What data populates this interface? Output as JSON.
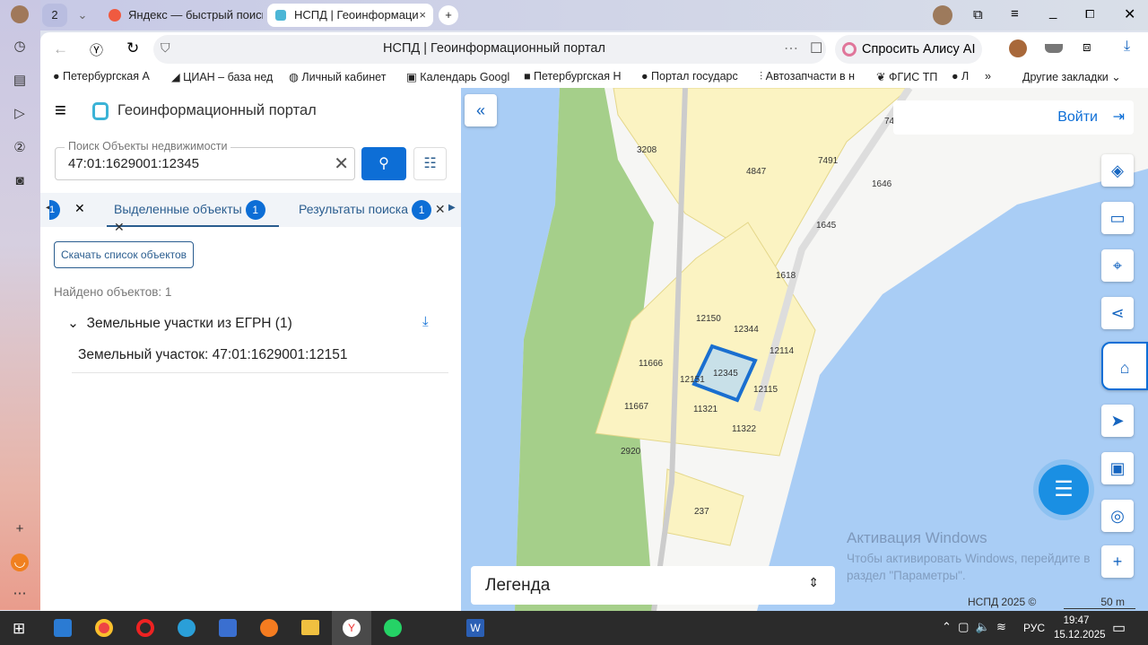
{
  "browser": {
    "tab_count": "2",
    "tabs": [
      {
        "label": "Яндекс — быстрый поиск"
      },
      {
        "label": "НСПД | Геоинформаци"
      }
    ],
    "address_title": "НСПД | Геоинформационный портал",
    "alice_label": "Спросить Алису AI",
    "bookmarks": [
      "Петербургская А",
      "ЦИАН – база нед",
      "Личный кабинет",
      "Календарь Googl",
      "Петербургская Н",
      "Портал государс",
      "Автозапчасти в н",
      "ФГИС ТП",
      "Л"
    ],
    "other_bookmarks": "Другие закладки"
  },
  "portal": {
    "title": "Геоинформационный портал",
    "search": {
      "label": "Поиск Объекты недвижимости",
      "value": "47:01:1629001:12345"
    },
    "tabs": [
      {
        "label": "",
        "count": "1"
      },
      {
        "label": "Выделенные объекты",
        "count": "1"
      },
      {
        "label": "Результаты поиска",
        "count": "1"
      }
    ],
    "download_button": "Скачать список объектов",
    "found": "Найдено объектов: 1",
    "group": "Земельные участки из ЕГРН (1)",
    "item": "Земельный участок: 47:01:1629001:12151"
  },
  "map": {
    "login": "Войти",
    "legend": "Легенда",
    "copyright": "НСПД 2025 ©",
    "scale": "50 m",
    "parcels": [
      "3208",
      "4847",
      "7491",
      "1646",
      "1645",
      "1618",
      "12150",
      "12344",
      "12114",
      "11666",
      "12345",
      "12151",
      "12115",
      "11667",
      "11321",
      "11322",
      "2920",
      "237",
      "74"
    ],
    "watermark_title": "Активация Windows",
    "watermark_text": "Чтобы активировать Windows, перейдите в раздел \"Параметры\"."
  },
  "taskbar": {
    "lang": "РУС",
    "time": "19:47",
    "date": "15.12.2025"
  },
  "colors": {
    "accent": "#0d6ed6",
    "water": "#a9cdf5",
    "green": "#a5cf8a",
    "parcel": "#fbf3c2"
  }
}
